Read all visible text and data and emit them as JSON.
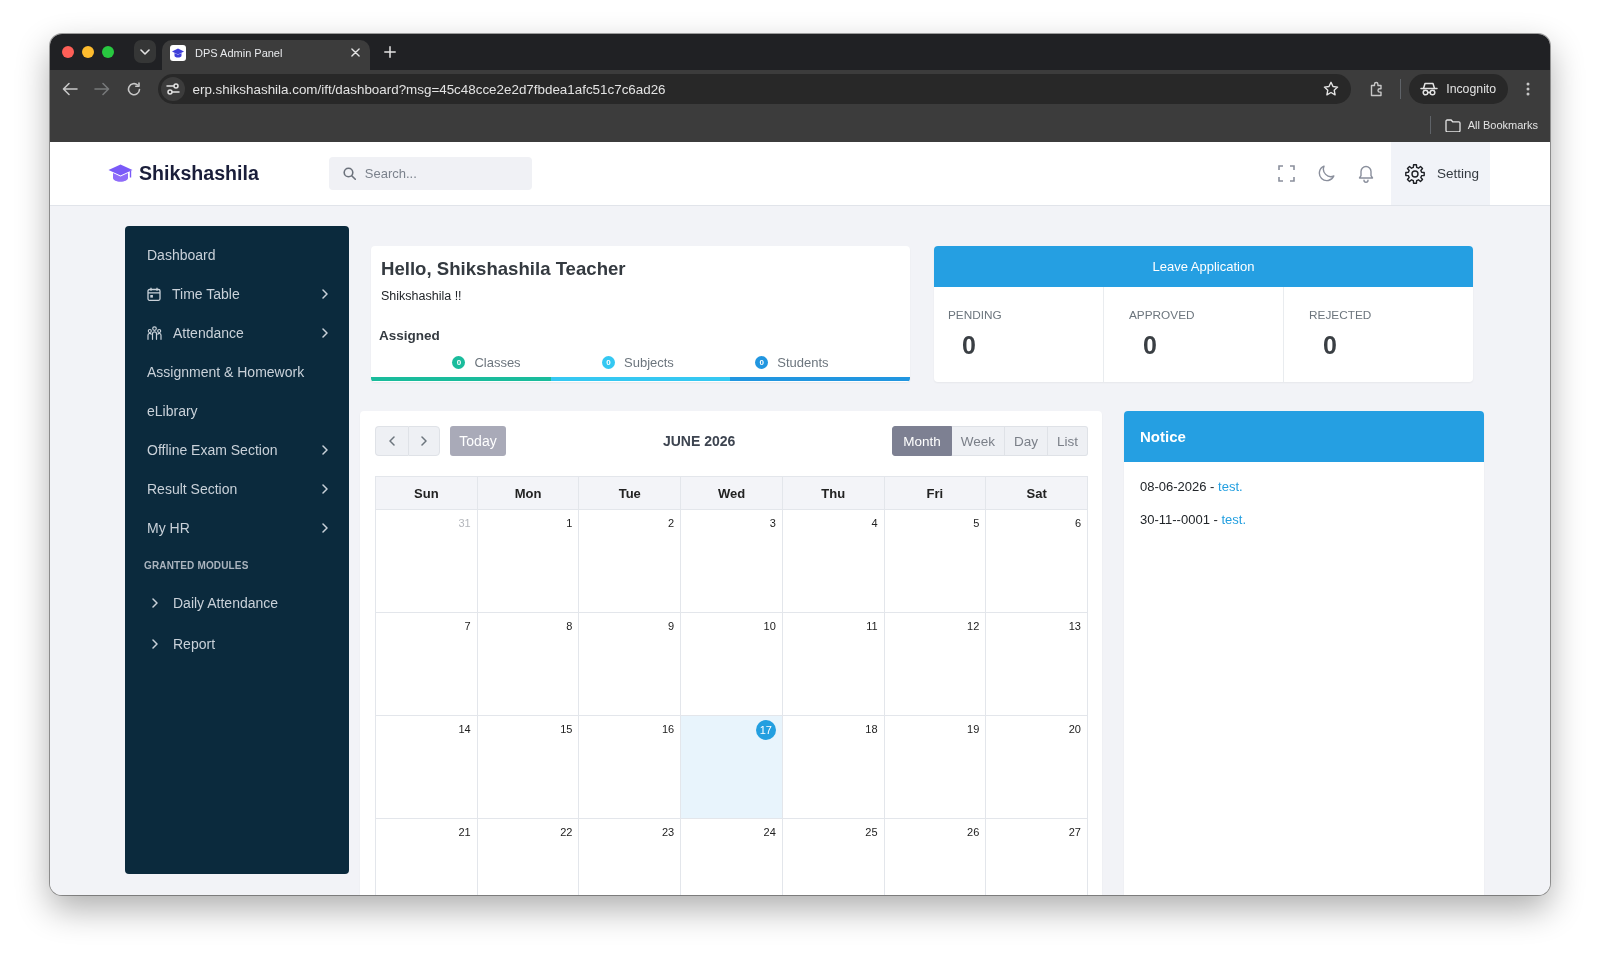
{
  "browser": {
    "tabs": [
      {
        "title": "DPS Admin Panel",
        "selected": true
      }
    ],
    "back": {
      "disabled": false
    },
    "forward": {
      "disabled": true
    },
    "url": "erp.shikshashila.com/ift/dashboard?msg=45c48cce2e2d7fbdea1afc51c7c6ad26",
    "profile": "Incognito",
    "bookmarks_label": "All Bookmarks"
  },
  "header": {
    "brand": "Shikshashila",
    "search": {
      "placeholder": "Search..."
    },
    "settings_label": "Setting"
  },
  "sidebar": {
    "items": [
      {
        "label": "Dashboard"
      },
      {
        "label": "Time Table",
        "expanded": false
      },
      {
        "label": "Attendance",
        "expanded": false
      },
      {
        "label": "Assignment & Homework"
      },
      {
        "label": "eLibrary"
      },
      {
        "label": "Offline Exam Section",
        "expanded": false
      },
      {
        "label": "Result Section",
        "expanded": false
      },
      {
        "label": "My HR",
        "expanded": false
      }
    ],
    "sections": [
      {
        "title": "GRANTED MODULES",
        "items": [
          {
            "label": "Daily Attendance",
            "expanded": false
          },
          {
            "label": "Report",
            "expanded": false
          }
        ]
      }
    ]
  },
  "greeting": {
    "title": "Hello, Shikshashila Teacher",
    "subtitle": "Shikshashila !!",
    "assigned_label": "Assigned",
    "assigned": [
      {
        "count": "0",
        "label": "Classes",
        "color": "#1abc9c"
      },
      {
        "count": "0",
        "label": "Subjects",
        "color": "#35c8f2"
      },
      {
        "count": "0",
        "label": "Students",
        "color": "#2196e0"
      }
    ]
  },
  "leave_application": {
    "title": "Leave Application",
    "stats": [
      {
        "label": "PENDING",
        "value": "0"
      },
      {
        "label": "APPROVED",
        "value": "0"
      },
      {
        "label": "REJECTED",
        "value": "0"
      }
    ]
  },
  "calendar": {
    "title": "JUNE 2026",
    "today_button": {
      "label": "Today",
      "disabled": true
    },
    "views": [
      {
        "label": "Month",
        "selected": true
      },
      {
        "label": "Week",
        "selected": false
      },
      {
        "label": "Day",
        "selected": false
      },
      {
        "label": "List",
        "selected": false
      }
    ],
    "weekdays": [
      "Sun",
      "Mon",
      "Tue",
      "Wed",
      "Thu",
      "Fri",
      "Sat"
    ],
    "weeks": [
      {
        "days": [
          {
            "day": "31",
            "other_month": true,
            "today": false
          },
          {
            "day": "1",
            "other_month": false,
            "today": false
          },
          {
            "day": "2",
            "other_month": false,
            "today": false
          },
          {
            "day": "3",
            "other_month": false,
            "today": false
          },
          {
            "day": "4",
            "other_month": false,
            "today": false
          },
          {
            "day": "5",
            "other_month": false,
            "today": false
          },
          {
            "day": "6",
            "other_month": false,
            "today": false
          }
        ]
      },
      {
        "days": [
          {
            "day": "7",
            "other_month": false,
            "today": false
          },
          {
            "day": "8",
            "other_month": false,
            "today": false
          },
          {
            "day": "9",
            "other_month": false,
            "today": false
          },
          {
            "day": "10",
            "other_month": false,
            "today": false
          },
          {
            "day": "11",
            "other_month": false,
            "today": false
          },
          {
            "day": "12",
            "other_month": false,
            "today": false
          },
          {
            "day": "13",
            "other_month": false,
            "today": false
          }
        ]
      },
      {
        "days": [
          {
            "day": "14",
            "other_month": false,
            "today": false
          },
          {
            "day": "15",
            "other_month": false,
            "today": false
          },
          {
            "day": "16",
            "other_month": false,
            "today": false
          },
          {
            "day": "17",
            "other_month": false,
            "today": true
          },
          {
            "day": "18",
            "other_month": false,
            "today": false
          },
          {
            "day": "19",
            "other_month": false,
            "today": false
          },
          {
            "day": "20",
            "other_month": false,
            "today": false
          }
        ]
      },
      {
        "days": [
          {
            "day": "21",
            "other_month": false,
            "today": false
          },
          {
            "day": "22",
            "other_month": false,
            "today": false
          },
          {
            "day": "23",
            "other_month": false,
            "today": false
          },
          {
            "day": "24",
            "other_month": false,
            "today": false
          },
          {
            "day": "25",
            "other_month": false,
            "today": false
          },
          {
            "day": "26",
            "other_month": false,
            "today": false
          },
          {
            "day": "27",
            "other_month": false,
            "today": false
          }
        ]
      }
    ]
  },
  "notice": {
    "title": "Notice",
    "items": [
      {
        "text": "08-06-2026 -",
        "link": "test."
      },
      {
        "text": "30-11--0001 -",
        "link": "test."
      }
    ]
  }
}
